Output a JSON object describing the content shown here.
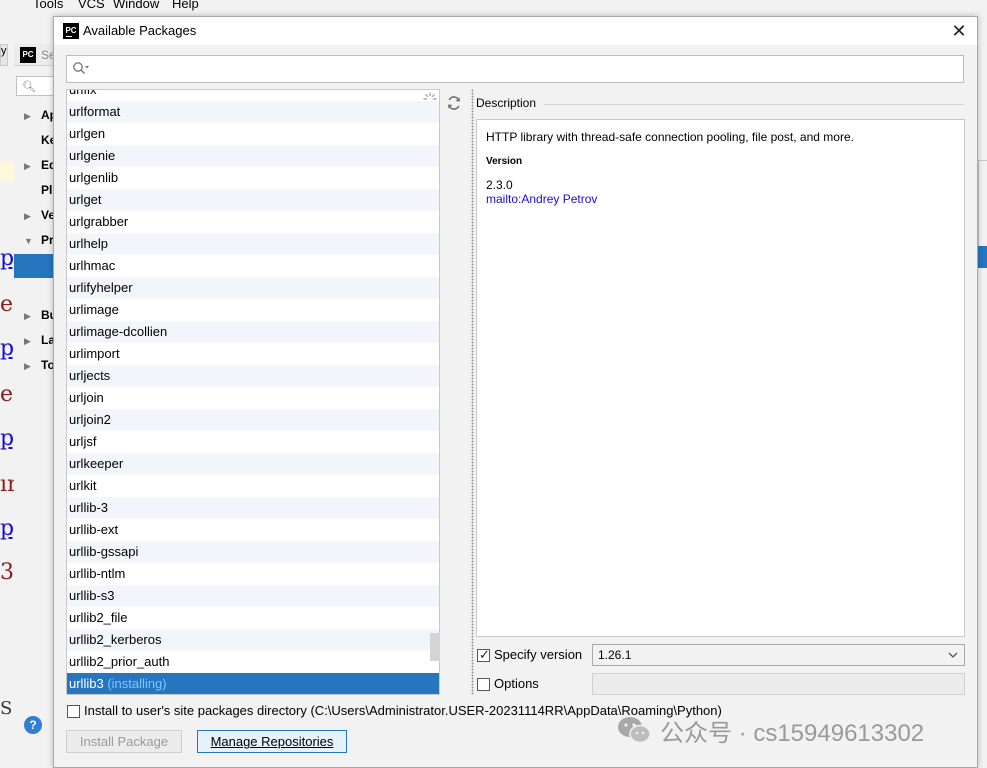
{
  "background": {
    "menubar": [
      "Tools",
      "VCS",
      "Window",
      "Help"
    ],
    "settings_title": "Se",
    "tab_label": "y",
    "tree_items": [
      "Ap",
      "Ke",
      "Ed",
      "Pl",
      "Ve",
      "Pr",
      "Bu",
      "La",
      "To"
    ],
    "code_fragments": [
      "py",
      "e",
      "py",
      "en",
      "py",
      "ır",
      "py",
      "3",
      "S"
    ],
    "help": "?"
  },
  "dialog": {
    "title": "Available Packages",
    "search": {
      "value": "",
      "placeholder": ""
    },
    "packages": [
      "urlfix",
      "urlformat",
      "urlgen",
      "urlgenie",
      "urlgenlib",
      "urlget",
      "urlgrabber",
      "urlhelp",
      "urlhmac",
      "urlifyhelper",
      "urlimage",
      "urlimage-dcollien",
      "urlimport",
      "urljects",
      "urljoin",
      "urljoin2",
      "urljsf",
      "urlkeeper",
      "urlkit",
      "urllib-3",
      "urllib-ext",
      "urllib-gssapi",
      "urllib-ntlm",
      "urllib-s3",
      "urllib2_file",
      "urllib2_kerberos",
      "urllib2_prior_auth"
    ],
    "selected_package": {
      "name": "urllib3",
      "status": "(installing)"
    },
    "description": {
      "label": "Description",
      "text": "HTTP library with thread-safe connection pooling, file post, and more.",
      "version_label": "Version",
      "version": "2.3.0",
      "author": "mailto:Andrey Petrov"
    },
    "specify_version": {
      "label": "Specify version",
      "checked": true,
      "value": "1.26.1"
    },
    "options": {
      "label": "Options",
      "checked": false,
      "value": ""
    },
    "install_user": {
      "label": "Install to user's site packages directory (C:\\Users\\Administrator.USER-20231114RR\\AppData\\Roaming\\Python)",
      "checked": false
    },
    "buttons": {
      "install": "Install Package",
      "manage": "Manage Repositories"
    }
  },
  "watermark": "公众号 · cs15949613302",
  "colors": {
    "selection": "#2675bf",
    "link": "#1a0dcc",
    "installing": "#3aa0ff"
  }
}
